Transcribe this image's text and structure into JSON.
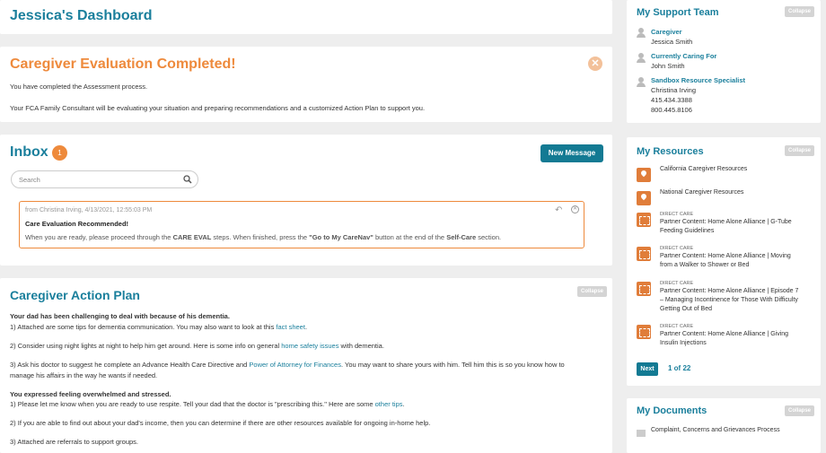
{
  "dashboard": {
    "title": "Jessica's Dashboard"
  },
  "evaluation": {
    "title": "Caregiver Evaluation Completed!",
    "line1": "You have completed the Assessment process.",
    "line2": "Your FCA Family Consultant will be evaluating your situation and preparing recommendations and a customized Action Plan to support you."
  },
  "inbox": {
    "title": "Inbox",
    "count": "1",
    "new_message_label": "New Message",
    "search_placeholder": "Search",
    "message": {
      "from": "from Christina Irving, 4/13/2021, 12:55:03 PM",
      "subject": "Care Evaluation Recommended!",
      "body_a": "When you are ready, please proceed through the ",
      "body_b": "CARE EVAL",
      "body_c": " steps. When finished, press the ",
      "body_d": "\"Go to My CareNav\"",
      "body_e": " button at the end of the ",
      "body_f": "Self-Care",
      "body_g": " section."
    }
  },
  "plan": {
    "title": "Caregiver Action Plan",
    "collapse_label": "Collapse",
    "section1_heading": "Your dad has been challenging to deal with because of his dementia.",
    "item1a": "1) Attached are some tips for dementia communication. You may also want to look at this ",
    "item1_link": "fact sheet",
    "item1b": ".",
    "item2a": "2) Consider using night lights at night to help him get around. Here is some info on general ",
    "item2_link": "home safety issues",
    "item2b": " with dementia.",
    "item3a": "3) Ask his doctor to suggest he complete an Advance Health Care Directive and ",
    "item3_link": "Power of Attorney for Finances",
    "item3b": ". You may want to share yours with him. Tell him this is so you know how to",
    "item3c": "manage his affairs in the way he wants if needed.",
    "section2_heading": "You expressed feeling overwhelmed and stressed.",
    "item4a": "1) Please let me know when you are ready to use respite. Tell your dad that the doctor is \"prescribing this.\" Here are some ",
    "item4_link": "other tips",
    "item4b": ".",
    "item5": "2) If you are able to find out about your dad's income, then you can determine if there are other resources available for ongoing in-home help.",
    "item6": "3) Attached are referrals to support groups."
  },
  "team": {
    "title": "My Support Team",
    "collapse_label": "Collapse",
    "members": [
      {
        "role": "Caregiver",
        "name": "Jessica Smith"
      },
      {
        "role": "Currently Caring For",
        "name": "John Smith"
      },
      {
        "role": "Sandbox Resource Specialist",
        "name": "Christina Irving",
        "phone1": "415.434.3388",
        "phone2": "800.445.8106"
      }
    ]
  },
  "resources": {
    "title": "My Resources",
    "collapse_label": "Collapse",
    "items": [
      {
        "title": "California Caregiver Resources"
      },
      {
        "title": "National Caregiver Resources"
      },
      {
        "category": "DIRECT CARE",
        "line1": "Partner Content: Home Alone Alliance | G-Tube",
        "line2": "Feeding Guidelines"
      },
      {
        "category": "DIRECT CARE",
        "line1": "Partner Content: Home Alone Alliance | Moving",
        "line2": "from a Walker to Shower or Bed"
      },
      {
        "category": "DIRECT CARE",
        "line1": "Partner Content: Home Alone Alliance | Episode 7",
        "line2": "– Managing Incontinence for Those With Difficulty",
        "line3": "Getting Out of Bed"
      },
      {
        "category": "DIRECT CARE",
        "line1": "Partner Content: Home Alone Alliance | Giving",
        "line2": "Insulin Injections"
      }
    ],
    "next_label": "Next",
    "page_indicator": "1 of 22"
  },
  "documents": {
    "title": "My Documents",
    "collapse_label": "Collapse",
    "items": [
      {
        "title": "Complaint, Concerns and Grievances Process"
      }
    ]
  },
  "colors": {
    "brand": "#1a7f9c",
    "accent": "#ee8a3c",
    "button": "#137a93"
  },
  "icons": [
    "search-icon",
    "close-icon",
    "reply-icon",
    "person-icon",
    "map-pin-icon",
    "video-icon",
    "document-icon"
  ]
}
